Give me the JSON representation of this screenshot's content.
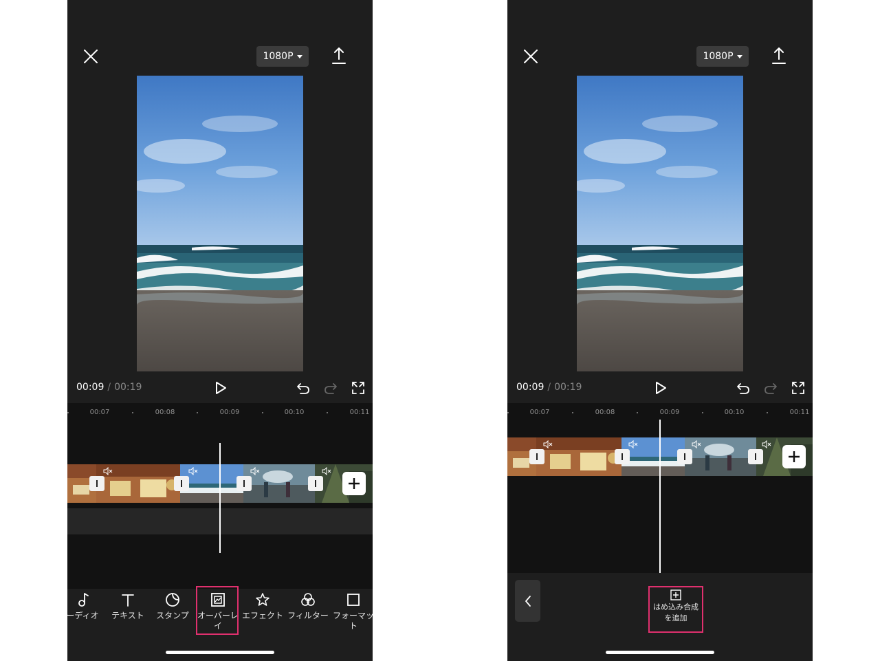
{
  "colors": {
    "highlight": "#e0306e",
    "background": "#1e1e1e",
    "timeline_bg": "#121212"
  },
  "screens": [
    {
      "id": "left",
      "header": {
        "close_icon": "close-icon",
        "resolution": "1080P",
        "export_icon": "export-icon"
      },
      "player": {
        "current_time": "00:09",
        "separator": "/",
        "total_time": "00:19"
      },
      "ruler": [
        "00:07",
        "00:08",
        "00:09",
        "00:10",
        "00:11"
      ],
      "toolbar": {
        "items": [
          {
            "label": "ーディオ",
            "icon": "music-note-icon"
          },
          {
            "label": "テキスト",
            "icon": "text-icon"
          },
          {
            "label": "スタンプ",
            "icon": "sticker-icon"
          },
          {
            "label": "オーバーレイ",
            "icon": "overlay-icon",
            "highlighted": true
          },
          {
            "label": "エフェクト",
            "icon": "effect-star-icon"
          },
          {
            "label": "フィルター",
            "icon": "filter-icon"
          },
          {
            "label": "フォーマット",
            "icon": "format-icon"
          }
        ]
      }
    },
    {
      "id": "right",
      "header": {
        "close_icon": "close-icon",
        "resolution": "1080P",
        "export_icon": "export-icon"
      },
      "player": {
        "current_time": "00:09",
        "separator": "/",
        "total_time": "00:19"
      },
      "ruler": [
        "00:07",
        "00:08",
        "00:09",
        "00:10",
        "00:11"
      ],
      "overlay_panel": {
        "add_label_line1": "はめ込み合成",
        "add_label_line2": "を追加",
        "back_icon": "chevron-left-icon"
      }
    }
  ]
}
